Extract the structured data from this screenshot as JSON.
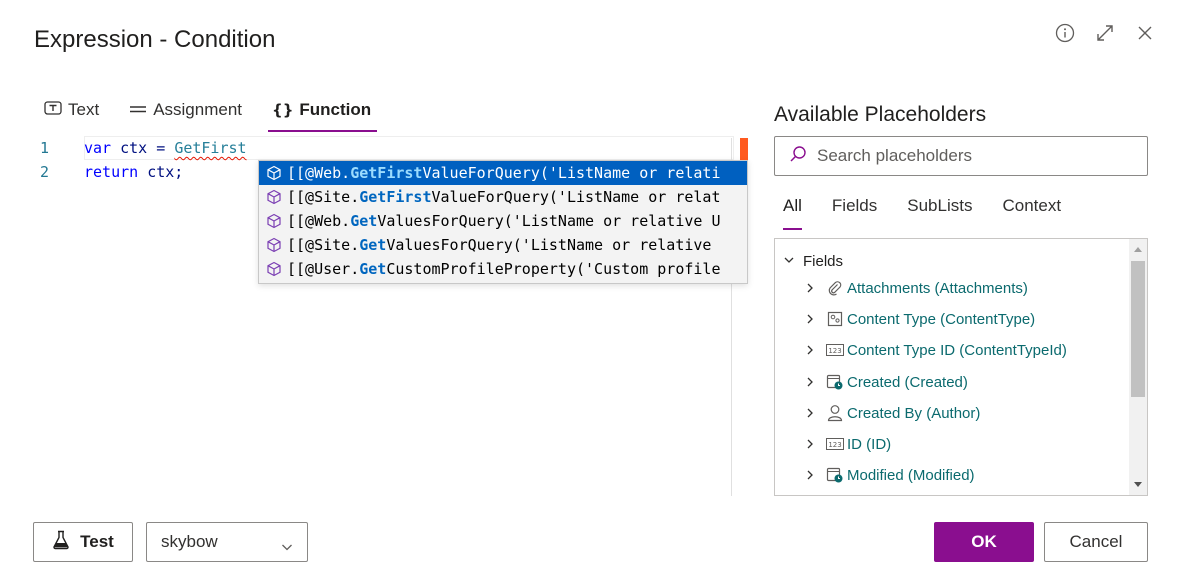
{
  "dialog": {
    "title": "Expression - Condition"
  },
  "header_icons": [
    "info-icon",
    "expand-icon",
    "close-icon"
  ],
  "tabs": [
    {
      "label": "Text",
      "icon": "text-icon",
      "active": false
    },
    {
      "label": "Assignment",
      "icon": "equals-icon",
      "active": false
    },
    {
      "label": "Function",
      "icon": "braces-icon",
      "active": true
    }
  ],
  "editor": {
    "lines": [
      {
        "number": "1",
        "keyword": "var",
        "ident": " ctx = ",
        "func": "GetFirst"
      },
      {
        "number": "2",
        "keyword": "return",
        "ident": " ctx;"
      }
    ],
    "suggestions": [
      {
        "pre": "[[@Web.",
        "match": "GetFirst",
        "post": "ValueForQuery('ListName or relati",
        "icon": "cube-icon",
        "selected": true
      },
      {
        "pre": "[[@Site.",
        "match": "GetFirst",
        "post": "ValueForQuery('ListName or relat",
        "icon": "cube-icon",
        "selected": false
      },
      {
        "pre": "[[@Web.",
        "match": "Get",
        "post": "ValuesForQuery('ListName or relative U",
        "icon": "cube-icon",
        "selected": false
      },
      {
        "pre": "[[@Site.",
        "match": "Get",
        "post": "ValuesForQuery('ListName or relative ",
        "icon": "cube-icon",
        "selected": false
      },
      {
        "pre": "[[@User.",
        "match": "Get",
        "post": "CustomProfileProperty('Custom profile",
        "icon": "cube-icon",
        "selected": false
      }
    ]
  },
  "placeholders": {
    "title": "Available Placeholders",
    "search_placeholder": "Search placeholders",
    "tabs": [
      {
        "label": "All",
        "active": true
      },
      {
        "label": "Fields",
        "active": false
      },
      {
        "label": "SubLists",
        "active": false
      },
      {
        "label": "Context",
        "active": false
      }
    ],
    "tree_root": "Fields",
    "items": [
      {
        "label": "Attachments (Attachments)",
        "icon": "paperclip-icon"
      },
      {
        "label": "Content Type (ContentType)",
        "icon": "content-type-icon"
      },
      {
        "label": "Content Type ID (ContentTypeId)",
        "icon": "number-icon"
      },
      {
        "label": "Created (Created)",
        "icon": "calendar-clock-icon"
      },
      {
        "label": "Created By (Author)",
        "icon": "person-icon"
      },
      {
        "label": "ID (ID)",
        "icon": "number-icon"
      },
      {
        "label": "Modified (Modified)",
        "icon": "calendar-clock-icon"
      }
    ]
  },
  "footer": {
    "test_label": "Test",
    "user_select_value": "skybow",
    "ok_label": "OK",
    "cancel_label": "Cancel"
  },
  "colors": {
    "accent": "#8a0e8f",
    "selection": "#0060c0",
    "field_text": "#0b6a6e"
  }
}
